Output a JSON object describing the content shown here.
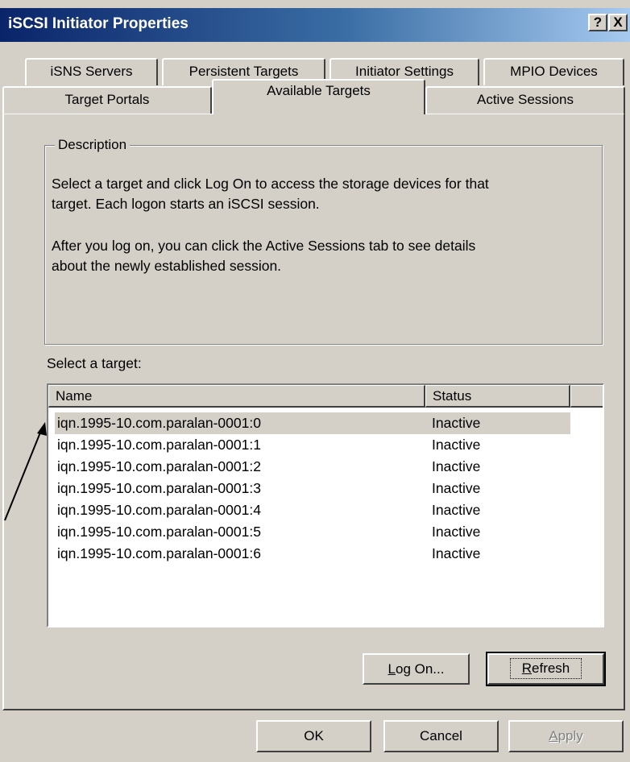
{
  "window": {
    "title": "iSCSI Initiator Properties",
    "help_button": "?",
    "close_button": "X"
  },
  "tabs": {
    "row_back": [
      "iSNS Servers",
      "Persistent Targets",
      "Initiator Settings",
      "MPIO Devices"
    ],
    "row_front": [
      "Target Portals",
      "Available Targets",
      "Active Sessions"
    ],
    "active": "Available Targets"
  },
  "description": {
    "legend": "Description",
    "paragraph1_line1": "Select a target and click Log On to access the storage devices for that",
    "paragraph1_line2": "target. Each logon starts an iSCSI session.",
    "paragraph2_line1": "After you log on, you can click the Active Sessions tab to see details",
    "paragraph2_line2": "about the newly established session."
  },
  "target_list": {
    "label": "Select a target:",
    "columns": [
      "Name",
      "Status"
    ],
    "rows": [
      {
        "name": "iqn.1995-10.com.paralan-0001:0",
        "status": "Inactive"
      },
      {
        "name": "iqn.1995-10.com.paralan-0001:1",
        "status": "Inactive"
      },
      {
        "name": "iqn.1995-10.com.paralan-0001:2",
        "status": "Inactive"
      },
      {
        "name": "iqn.1995-10.com.paralan-0001:3",
        "status": "Inactive"
      },
      {
        "name": "iqn.1995-10.com.paralan-0001:4",
        "status": "Inactive"
      },
      {
        "name": "iqn.1995-10.com.paralan-0001:5",
        "status": "Inactive"
      },
      {
        "name": "iqn.1995-10.com.paralan-0001:6",
        "status": "Inactive"
      }
    ],
    "selected_index": 0
  },
  "panel_buttons": {
    "logon_prefix": "L",
    "logon_rest": "og On...",
    "refresh_prefix": "R",
    "refresh_rest": "efresh"
  },
  "dialog_buttons": {
    "ok": "OK",
    "cancel": "Cancel",
    "apply_prefix": "A",
    "apply_rest": "pply"
  },
  "colors": {
    "face": "#d4d0c8",
    "title_start": "#0a246a",
    "title_end": "#a6caf0",
    "selection": "#d4d0c8",
    "disabled_text": "#808080"
  },
  "icons": {
    "annotation": "arrow-pointer-icon"
  }
}
